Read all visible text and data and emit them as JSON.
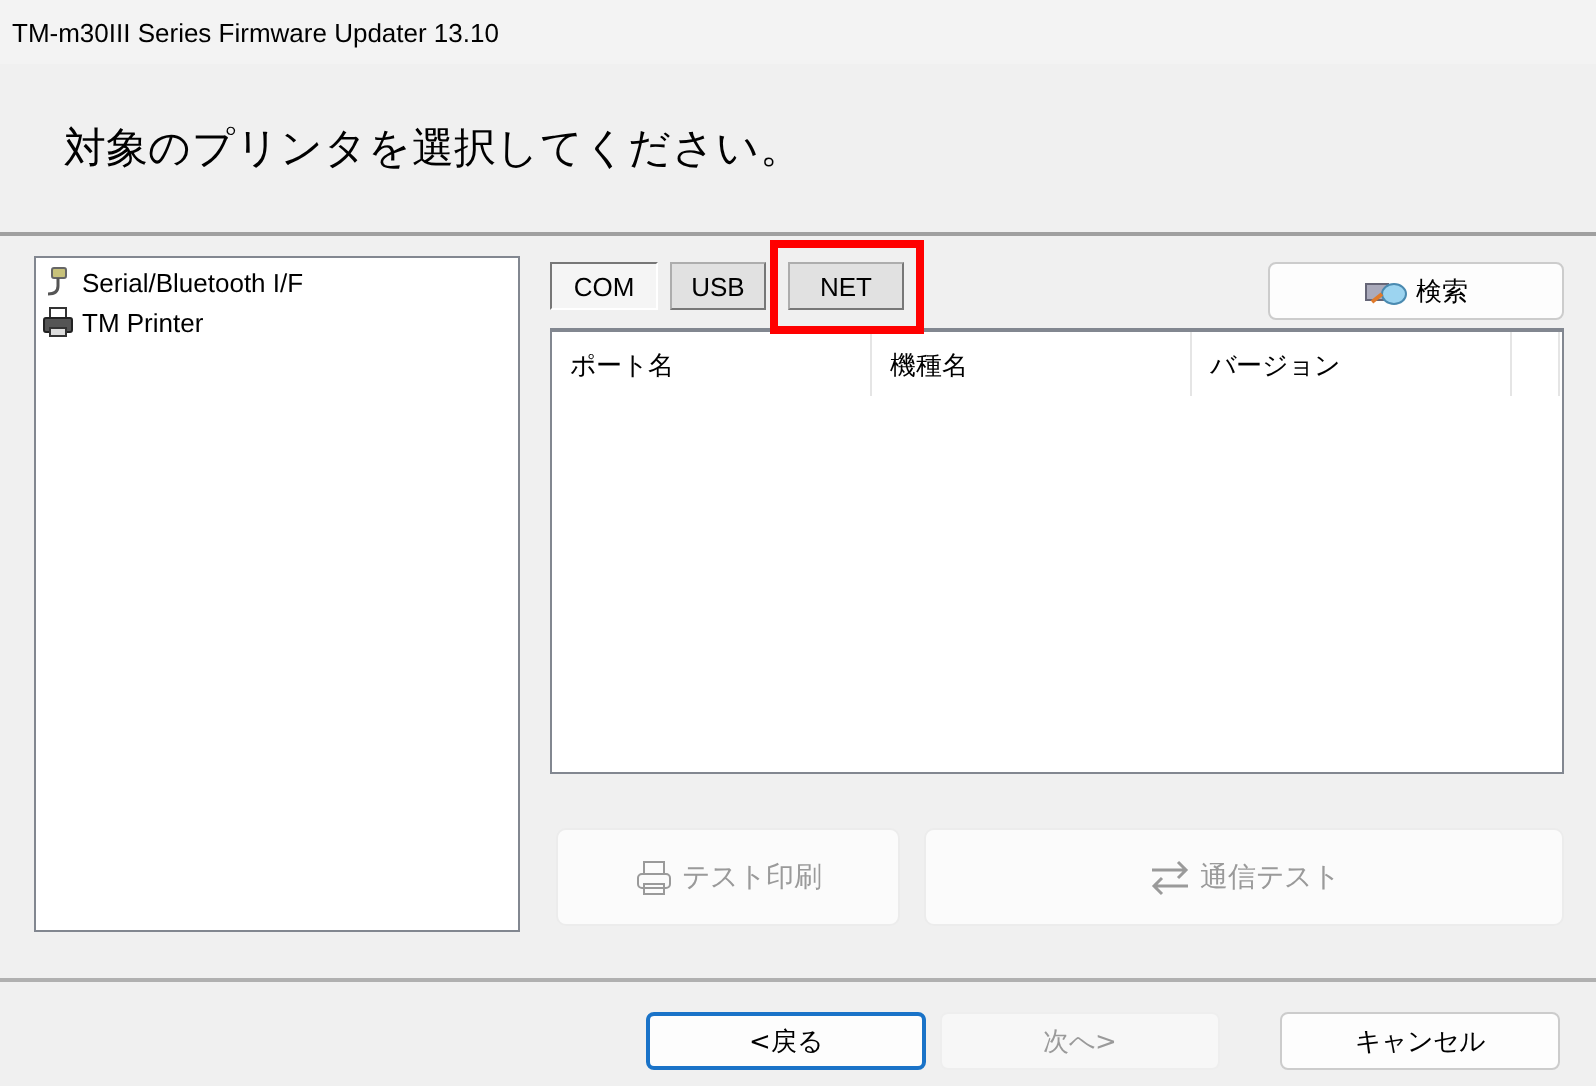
{
  "window": {
    "title": "TM-m30III Series Firmware Updater 13.10"
  },
  "heading": "対象のプリンタを選択してください。",
  "tree": [
    {
      "label": "Serial/Bluetooth I/F",
      "kind": "serial"
    },
    {
      "label": "TM Printer",
      "kind": "printer"
    }
  ],
  "tabs": [
    {
      "label": "COM",
      "selected": true,
      "highlighted": false
    },
    {
      "label": "USB",
      "selected": false,
      "highlighted": false
    },
    {
      "label": "NET",
      "selected": false,
      "highlighted": true
    }
  ],
  "search_button": {
    "label": "検索"
  },
  "table": {
    "columns": [
      "ポート名",
      "機種名",
      "バージョン"
    ]
  },
  "actions": [
    {
      "label": "テスト印刷",
      "kind": "print",
      "disabled": true
    },
    {
      "label": "通信テスト",
      "kind": "comm",
      "disabled": true
    }
  ],
  "footer_buttons": [
    {
      "label": "<戻る",
      "disabled": false,
      "default": true
    },
    {
      "label": "次へ>",
      "disabled": true,
      "default": false
    },
    {
      "label": "キャンセル",
      "disabled": false,
      "default": false
    }
  ]
}
